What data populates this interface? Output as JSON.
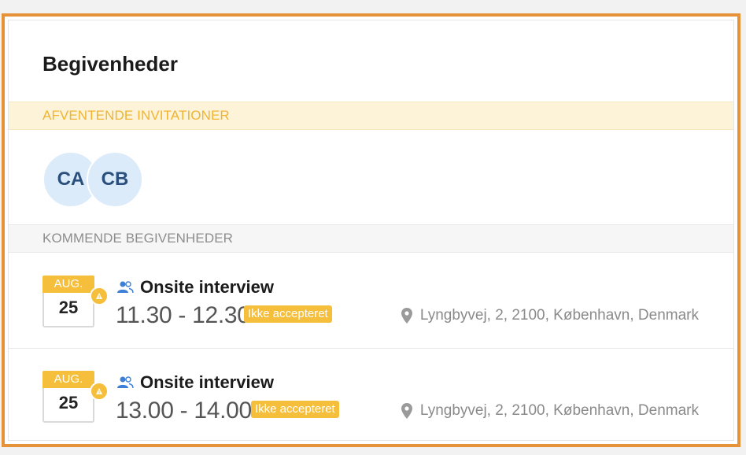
{
  "panel": {
    "title": "Begivenheder",
    "pending_label": "AFVENTENDE INVITATIONER",
    "upcoming_label": "KOMMENDE BEGIVENHEDER"
  },
  "pending_invitations": [
    {
      "initials": "CA"
    },
    {
      "initials": "CB"
    }
  ],
  "events": [
    {
      "month": "AUG.",
      "day": "25",
      "name": "Onsite interview",
      "time": "11.30 - 12.30",
      "status": "Ikke accepteret",
      "location": "Lyngbyvej, 2, 2100, København, Denmark",
      "icon": "people-icon"
    },
    {
      "month": "AUG.",
      "day": "25",
      "name": "Onsite interview",
      "time": "13.00 - 14.00",
      "status": "Ikke accepteret",
      "location": "Lyngbyvej, 2, 2100, København, Denmark",
      "icon": "people-icon"
    }
  ],
  "colors": {
    "frame": "#e59238",
    "accent_yellow": "#f5be3b",
    "avatar_bg": "#dcebf9",
    "avatar_text": "#2a4f7c"
  }
}
